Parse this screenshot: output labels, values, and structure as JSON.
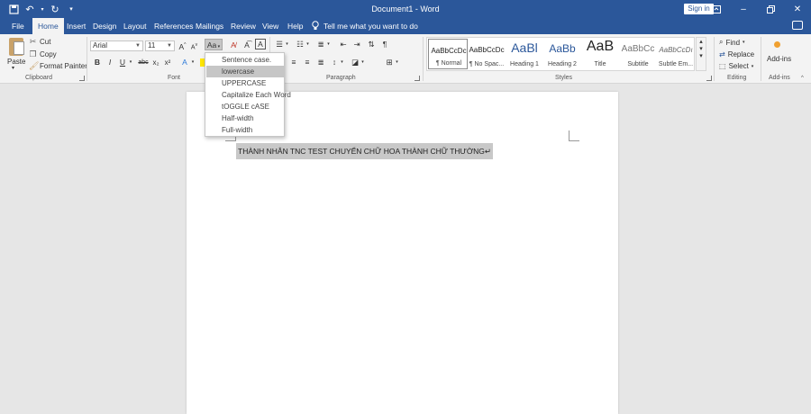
{
  "window": {
    "title": "Document1 - Word",
    "sign_in": "Sign in"
  },
  "tabs": [
    "File",
    "Home",
    "Insert",
    "Design",
    "Layout",
    "References",
    "Mailings",
    "Review",
    "View",
    "Help"
  ],
  "tell_me": "Tell me what you want to do",
  "clipboard": {
    "paste": "Paste",
    "cut": "Cut",
    "copy": "Copy",
    "format_painter": "Format Painter",
    "label": "Clipboard"
  },
  "font": {
    "name": "Arial",
    "size": "11",
    "label": "Font",
    "case_button": "Aa",
    "bold": "B",
    "italic": "I",
    "underline": "U",
    "strike": "abc",
    "subscript": "x₂",
    "superscript": "x²"
  },
  "paragraph": {
    "label": "Paragraph"
  },
  "styles": {
    "label": "Styles",
    "items": [
      {
        "sample": "AaBbCcDc",
        "name": "¶ Normal"
      },
      {
        "sample": "AaBbCcDc",
        "name": "¶ No Spac..."
      },
      {
        "sample": "AaBl",
        "name": "Heading 1"
      },
      {
        "sample": "AaBb",
        "name": "Heading 2"
      },
      {
        "sample": "AaB",
        "name": "Title"
      },
      {
        "sample": "AaBbCc",
        "name": "Subtitle"
      },
      {
        "sample": "AaBbCcDı",
        "name": "Subtle Em..."
      }
    ]
  },
  "editing": {
    "find": "Find",
    "replace": "Replace",
    "select": "Select",
    "label": "Editing"
  },
  "addins": {
    "button": "Add-ins",
    "label": "Add-ins"
  },
  "document": {
    "text": "THÀNH NHÂN TNC TEST CHUYỂN CHỮ HOA THÀNH CHỮ THƯỜNG↵"
  },
  "change_case_menu": {
    "items": [
      "Sentence case.",
      "lowercase",
      "UPPERCASE",
      "Capitalize Each Word",
      "tOGGLE cASE",
      "Half-width",
      "Full-width"
    ],
    "hovered_index": 1
  },
  "colors": {
    "title_bar": "#2b579a",
    "ribbon": "#f3f3f3",
    "canvas": "#e6e6e6",
    "selection": "#c8c8c8"
  }
}
